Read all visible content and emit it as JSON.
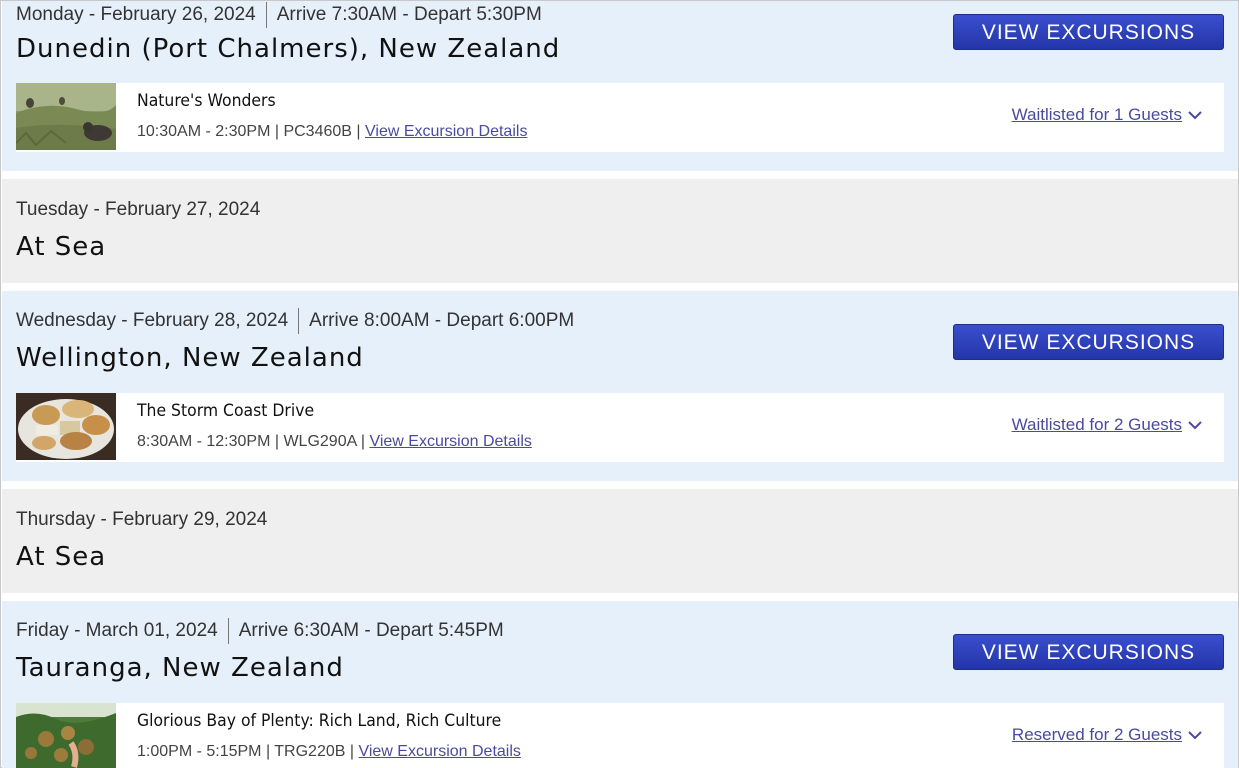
{
  "days": [
    {
      "type": "port",
      "date": "Monday - February 26, 2024",
      "times": "Arrive 7:30AM - Depart 5:30PM",
      "port": "Dunedin (Port Chalmers), New Zealand",
      "button": "VIEW EXCURSIONS",
      "excursion": {
        "name": "Nature's Wonders",
        "time": "10:30AM - 2:30PM",
        "code": "PC3460B",
        "details_link": "View Excursion Details",
        "status": "Waitlisted for 1 Guests",
        "image": "seals-on-grass-photo"
      }
    },
    {
      "type": "sea",
      "date": "Tuesday - February 27, 2024",
      "title": "At Sea"
    },
    {
      "type": "port",
      "date": "Wednesday - February 28, 2024",
      "times": "Arrive 8:00AM - Depart 6:00PM",
      "port": "Wellington, New Zealand",
      "button": "VIEW EXCURSIONS",
      "excursion": {
        "name": "The Storm Coast Drive",
        "time": "8:30AM - 12:30PM",
        "code": "WLG290A",
        "details_link": "View Excursion Details",
        "status": "Waitlisted for 2 Guests",
        "image": "pastries-plate-photo"
      }
    },
    {
      "type": "sea",
      "date": "Thursday - February 29, 2024",
      "title": "At Sea"
    },
    {
      "type": "port",
      "date": "Friday - March 01, 2024",
      "times": "Arrive 6:30AM - Depart 5:45PM",
      "port": "Tauranga, New Zealand",
      "button": "VIEW EXCURSIONS",
      "excursion": {
        "name": "Glorious Bay of Plenty: Rich Land, Rich Culture",
        "time": "1:00PM - 5:15PM",
        "code": "TRG220B",
        "details_link": "View Excursion Details",
        "status": "Reserved for 2 Guests",
        "image": "fruit-orchard-photo"
      }
    }
  ],
  "colors": {
    "port_bg": "#e6f0fb",
    "sea_bg": "#efefef",
    "button": "#2a3db8",
    "link": "#4a4aa0"
  },
  "separator": " | "
}
